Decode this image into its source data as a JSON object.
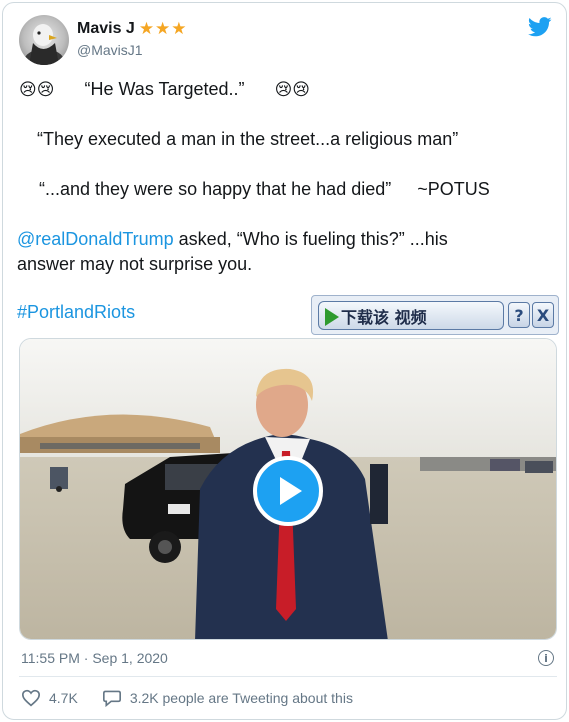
{
  "author": {
    "name": "Mavis J",
    "stars": "★★★",
    "handle": "@MavisJ1"
  },
  "tweet": {
    "emoji_left": "😢😢",
    "headline": "“He Was Targeted..”",
    "emoji_right": "😢😢",
    "quote1": "“They executed a man in the street...a religious man”",
    "quote2": "“...and they were so happy that he had died”",
    "attribution": "~POTUS",
    "mention": "@realDonaldTrump",
    "asked_text": " asked,  “Who is fueling this?” ...his",
    "line5b": "answer may not surprise you.",
    "hashtag": "#PortlandRiots"
  },
  "download_bar": {
    "label": "下载该 视频",
    "help": "?",
    "close": "X"
  },
  "meta": {
    "timestamp": "11:55 PM · Sep 1, 2020",
    "info": "i"
  },
  "actions": {
    "likes": "4.7K",
    "replies_text": "3.2K people are Tweeting about this"
  },
  "colors": {
    "link": "#1b95e0",
    "twitter_blue": "#1da1f2",
    "star": "#f5a623"
  }
}
